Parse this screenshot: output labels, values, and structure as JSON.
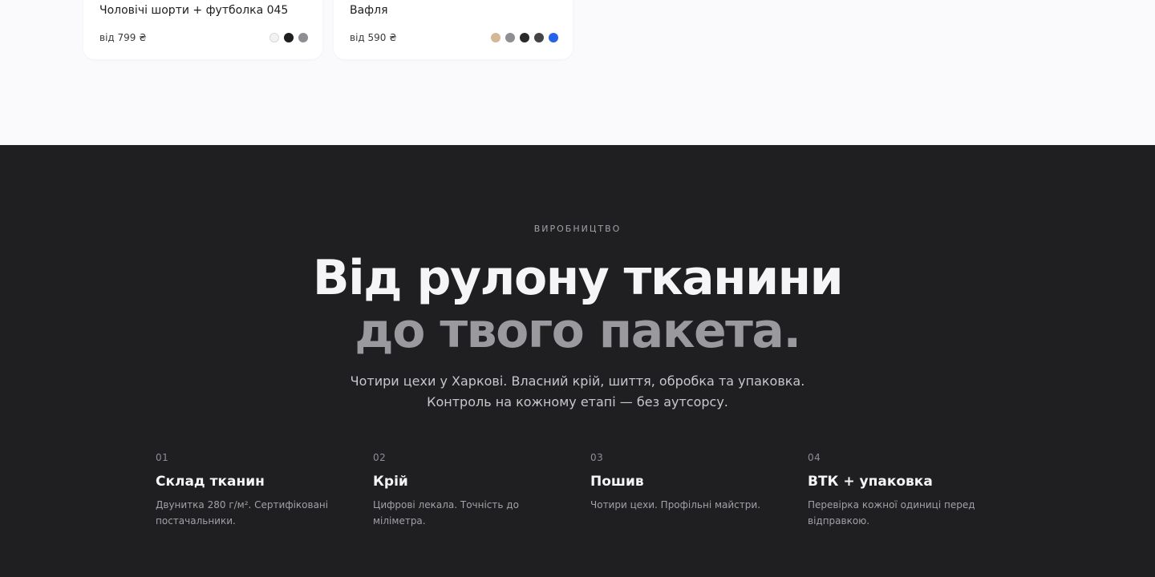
{
  "products": [
    {
      "title": "Чоловічі шорти + футболка 045",
      "price": "від 799 ₴",
      "swatches": [
        "#f2f2f2",
        "#1f1f21",
        "#8e8e93"
      ]
    },
    {
      "title": "Вафля",
      "price": "від 590 ₴",
      "swatches": [
        "#d4b896",
        "#8e8e93",
        "#2a2a2c",
        "#444446",
        "#2563eb"
      ]
    }
  ],
  "production": {
    "eyebrow": "ВИРОБНИЦТВО",
    "headline_line1": "Від рулону тканини",
    "headline_line2": "до твого пакета.",
    "lead": "Чотири цехи у Харкові. Власний крій, шиття, обробка та упаковка. Контроль на кожному етапі — без аутсорсу.",
    "steps": [
      {
        "num": "01",
        "title": "Склад тканин",
        "desc": "Двунитка 280 г/м². Сертифіковані постачальники."
      },
      {
        "num": "02",
        "title": "Крій",
        "desc": "Цифрові лекала. Точність до міліметра."
      },
      {
        "num": "03",
        "title": "Пошив",
        "desc": "Чотири цехи. Профільні майстри."
      },
      {
        "num": "04",
        "title": "ВТК + упаковка",
        "desc": "Перевірка кожної одиниці перед відправкою."
      }
    ]
  },
  "colors": {
    "dark_bg": "#1f1f21",
    "light_bg": "#fafafc"
  }
}
